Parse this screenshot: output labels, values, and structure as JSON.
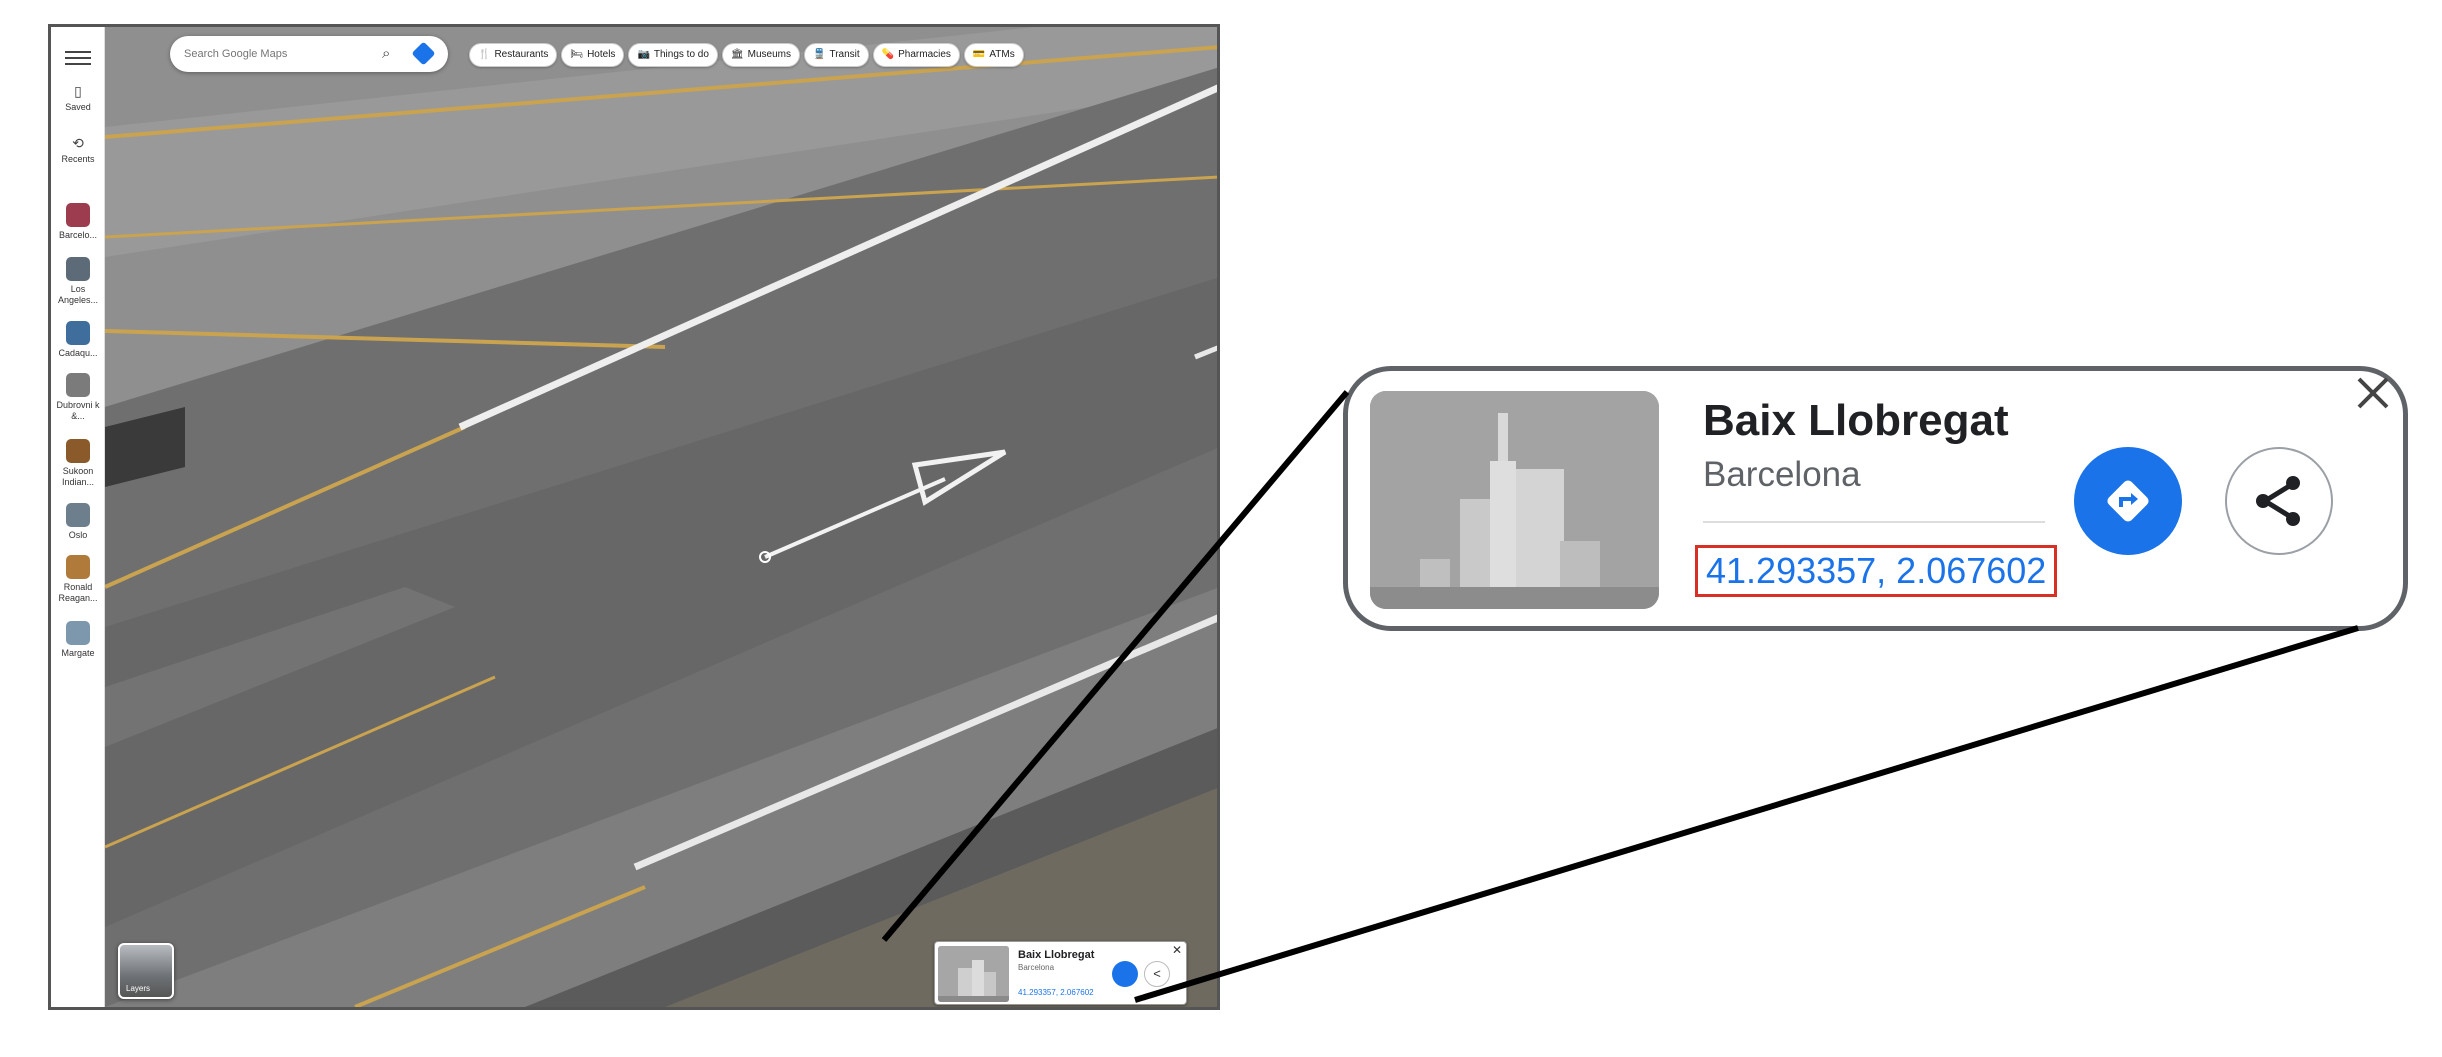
{
  "sidebar": {
    "items": [
      {
        "label": "Saved",
        "icon": "bookmark-icon"
      },
      {
        "label": "Recents",
        "icon": "history-icon"
      },
      {
        "label": "Barcelo...",
        "icon": "place-thumbnail"
      },
      {
        "label": "Los Angeles...",
        "icon": "place-thumbnail"
      },
      {
        "label": "Cadaqu...",
        "icon": "place-thumbnail"
      },
      {
        "label": "Dubrovni k &...",
        "icon": "place-thumbnail"
      },
      {
        "label": "Sukoon Indian...",
        "icon": "place-thumbnail"
      },
      {
        "label": "Oslo",
        "icon": "place-thumbnail"
      },
      {
        "label": "Ronald Reagan...",
        "icon": "place-thumbnail"
      },
      {
        "label": "Margate",
        "icon": "place-thumbnail"
      }
    ]
  },
  "search": {
    "placeholder": "Search Google Maps"
  },
  "chips": [
    {
      "label": "Restaurants",
      "icon": "utensils-icon",
      "glyph": "🍴"
    },
    {
      "label": "Hotels",
      "icon": "bed-icon",
      "glyph": "🛏"
    },
    {
      "label": "Things to do",
      "icon": "camera-icon",
      "glyph": "📷"
    },
    {
      "label": "Museums",
      "icon": "museum-icon",
      "glyph": "🏛"
    },
    {
      "label": "Transit",
      "icon": "transit-icon",
      "glyph": "🚆"
    },
    {
      "label": "Pharmacies",
      "icon": "pharmacy-icon",
      "glyph": "💊"
    },
    {
      "label": "ATMs",
      "icon": "atm-icon",
      "glyph": "💳"
    }
  ],
  "layers": {
    "label": "Layers"
  },
  "place_card": {
    "title": "Baix Llobregat",
    "subtitle": "Barcelona",
    "coordinates": "41.293357, 2.067602"
  },
  "colors": {
    "accent": "#1a73e8",
    "highlight_box": "#d93025",
    "tarmac": "#7e7e7e"
  }
}
